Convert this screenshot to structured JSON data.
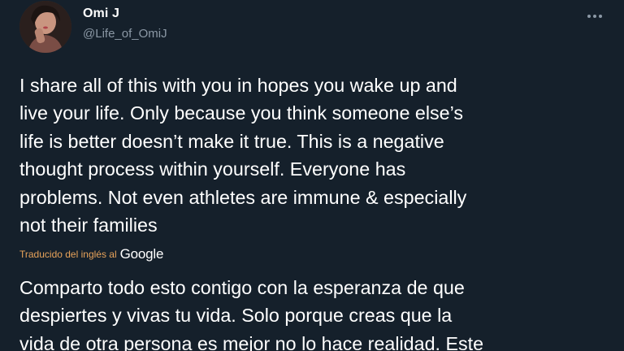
{
  "author": {
    "name": "Omi J",
    "handle": "@Life_of_OmiJ",
    "avatar_icon": "profile-photo"
  },
  "more_icon": "more-options-icon",
  "tweet": {
    "text": "I share all of this with you in hopes you wake up and\nlive your life. Only because you think someone else’s\nlife is better doesn’t make it true. This is a negative\nthought process within yourself. Everyone has\nproblems. Not even athletes are immune & especially\nnot their families"
  },
  "translation": {
    "label": "Traducido del inglés al",
    "provider": "Google",
    "text": "Comparto todo esto contigo con la esperanza de que\ndespiertes y vivas tu vida. Solo porque creas que la\nvida de otra persona es mejor no lo hace realidad. Este"
  },
  "colors": {
    "background": "#15202b",
    "text": "#ffffff",
    "secondary_text": "#8b98a5",
    "translation_label": "#e8a35a"
  }
}
